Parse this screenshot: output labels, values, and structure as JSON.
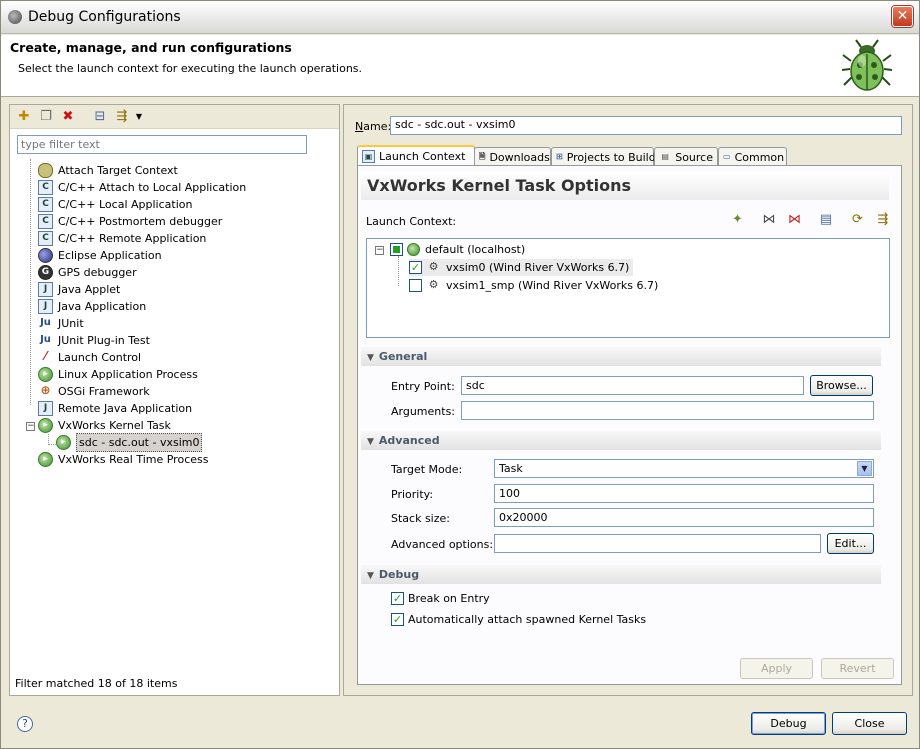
{
  "window": {
    "title": "Debug Configurations"
  },
  "header": {
    "title": "Create, manage, and run configurations",
    "description": "Select the launch context for executing the launch operations."
  },
  "left": {
    "filter_placeholder": "type filter text",
    "tree": [
      {
        "label": "Attach Target Context",
        "icon": "bug-target-icon"
      },
      {
        "label": "C/C++ Attach to Local Application",
        "icon": "c-icon"
      },
      {
        "label": "C/C++ Local Application",
        "icon": "c-icon"
      },
      {
        "label": "C/C++ Postmortem debugger",
        "icon": "c-icon"
      },
      {
        "label": "C/C++ Remote Application",
        "icon": "c-icon"
      },
      {
        "label": "Eclipse Application",
        "icon": "eclipse-icon"
      },
      {
        "label": "GPS debugger",
        "icon": "gps-icon"
      },
      {
        "label": "Java Applet",
        "icon": "java-applet-icon"
      },
      {
        "label": "Java Application",
        "icon": "java-icon"
      },
      {
        "label": "JUnit",
        "icon": "junit-icon"
      },
      {
        "label": "JUnit Plug-in Test",
        "icon": "junit-plugin-icon"
      },
      {
        "label": "Launch Control",
        "icon": "launch-control-icon"
      },
      {
        "label": "Linux Application Process",
        "icon": "process-icon"
      },
      {
        "label": "OSGi Framework",
        "icon": "osgi-icon"
      },
      {
        "label": "Remote Java Application",
        "icon": "remote-java-icon"
      },
      {
        "label": "VxWorks Kernel Task",
        "icon": "process-icon"
      },
      {
        "label": "sdc - sdc.out - vxsim0",
        "icon": "process-icon"
      },
      {
        "label": "VxWorks Real Time Process",
        "icon": "process-icon"
      }
    ],
    "filter_status": "Filter matched 18 of 18 items"
  },
  "right": {
    "name_label": "Name:",
    "name_value": "sdc - sdc.out - vxsim0",
    "tabs": [
      {
        "label": "Launch Context",
        "icon": "launch-context-icon"
      },
      {
        "label": "Downloads",
        "icon": "downloads-icon"
      },
      {
        "label": "Projects to Build",
        "icon": "projects-icon"
      },
      {
        "label": "Source",
        "icon": "source-icon"
      },
      {
        "label": "Common",
        "icon": "common-icon"
      }
    ],
    "options_title": "VxWorks Kernel Task Options",
    "launch_context_label": "Launch Context:",
    "context_tree": [
      {
        "label": "default (localhost)"
      },
      {
        "label": "vxsim0 (Wind River VxWorks 6.7)"
      },
      {
        "label": "vxsim1_smp (Wind River VxWorks 6.7)"
      }
    ],
    "general": {
      "title": "General",
      "entry_point_label": "Entry Point:",
      "entry_point_value": "sdc",
      "browse_label": "Browse...",
      "arguments_label": "Arguments:",
      "arguments_value": ""
    },
    "advanced": {
      "title": "Advanced",
      "target_mode_label": "Target Mode:",
      "target_mode_value": "Task",
      "priority_label": "Priority:",
      "priority_value": "100",
      "stack_size_label": "Stack size:",
      "stack_size_value": "0x20000",
      "advanced_options_label": "Advanced options:",
      "advanced_options_value": "",
      "edit_label": "Edit..."
    },
    "debug": {
      "title": "Debug",
      "break_on_entry": "Break on Entry",
      "auto_attach": "Automatically attach spawned Kernel Tasks"
    },
    "apply_label": "Apply",
    "revert_label": "Revert"
  },
  "footer": {
    "debug_label": "Debug",
    "close_label": "Close"
  }
}
